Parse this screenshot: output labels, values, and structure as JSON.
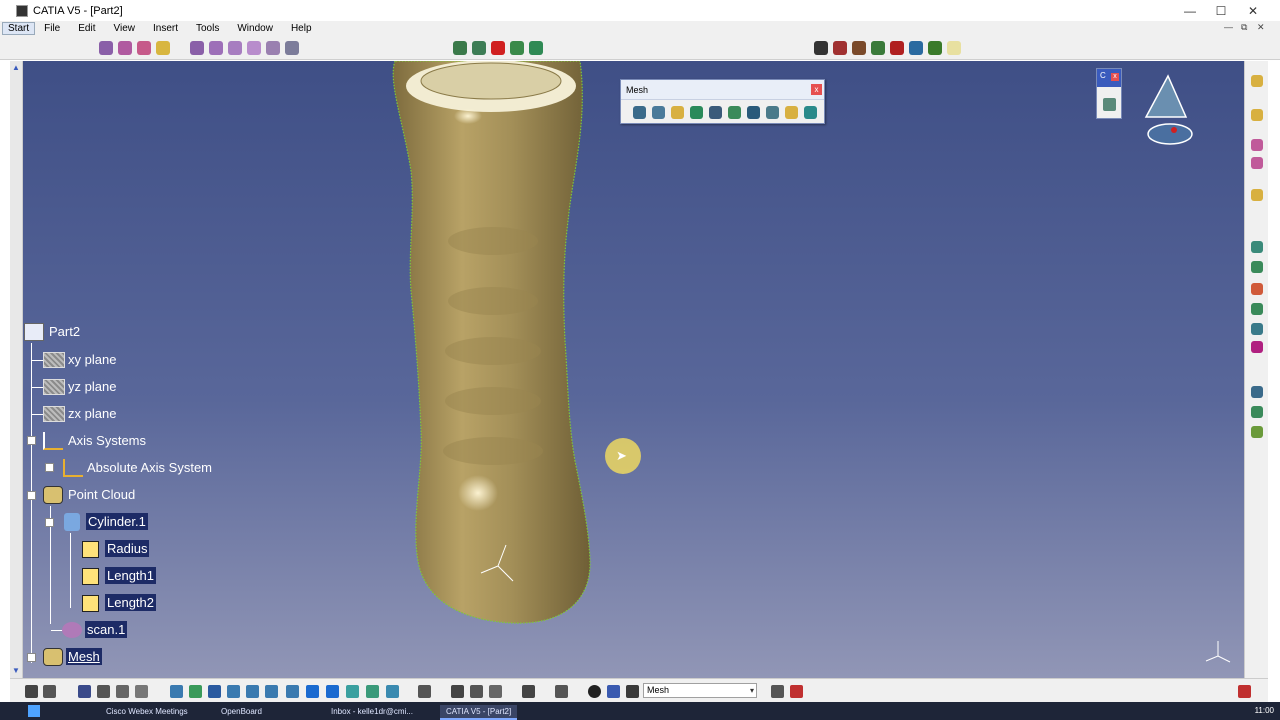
{
  "window": {
    "title": "CATIA V5 - [Part2]",
    "controls": [
      "—",
      "☐",
      "✕"
    ],
    "doc_controls": [
      "—",
      "⧉",
      "✕"
    ]
  },
  "menu": [
    "Start",
    "File",
    "Edit",
    "View",
    "Insert",
    "Tools",
    "Window",
    "Help"
  ],
  "mesh_toolbar": {
    "title": "Mesh",
    "close": "x"
  },
  "small_toolbar": {
    "title": "C",
    "close": "x"
  },
  "tree": {
    "root": "Part2",
    "items": [
      {
        "label": "xy plane"
      },
      {
        "label": "yz plane"
      },
      {
        "label": "zx plane"
      },
      {
        "label": "Axis Systems"
      },
      {
        "label": "Absolute Axis System"
      },
      {
        "label": "Point Cloud"
      },
      {
        "label": "Cylinder.1"
      },
      {
        "label": "Radius"
      },
      {
        "label": "Length1"
      },
      {
        "label": "Length2"
      },
      {
        "label": "scan.1"
      },
      {
        "label": "Mesh"
      }
    ]
  },
  "bottom": {
    "combo_value": "Mesh",
    "combo_arrow": "▾"
  },
  "taskbar": {
    "items": [
      "Cisco Webex Meetings",
      "OpenBoard",
      "Inbox - kelle1dr@cmi...",
      "CATIA V5 - [Part2]"
    ],
    "clock": "11:00"
  },
  "colors": {
    "viewport_top": "#3f4f86",
    "viewport_bottom": "#9196b6",
    "model": "#b09a5e",
    "mesh_edge": "#7ec83a",
    "tree_highlight": "#1d2b66"
  }
}
